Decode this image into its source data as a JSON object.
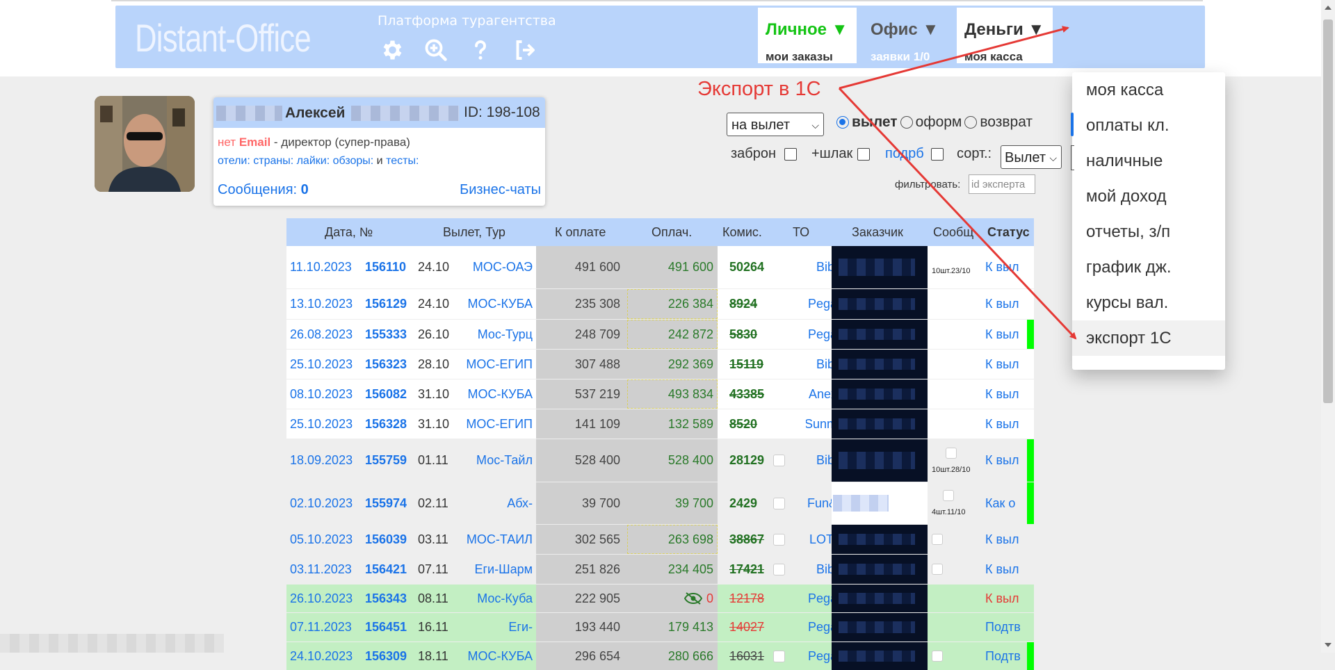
{
  "header": {
    "logo": "Distant-Office",
    "tagline": "Платформа турагентства",
    "icons": [
      "gear-icon",
      "search-plus-icon",
      "question-icon",
      "sign-out-icon"
    ],
    "tabs": {
      "personal": {
        "title": "Личное ▼",
        "sub": "мои заказы"
      },
      "office": {
        "title": "Офис ▼",
        "sub": "заявки 1/0"
      },
      "money": {
        "title": "Деньги ▼",
        "sub": "моя касса"
      }
    }
  },
  "dropdown": {
    "items": [
      "моя касса",
      "оплаты кл.",
      "наличные",
      "мой доход",
      "отчеты, з/п",
      "график дж.",
      "курсы вал.",
      "экспорт 1С"
    ]
  },
  "annotation": "Экспорт в 1С",
  "user": {
    "name": "Алексей",
    "id": "ID: 198-108",
    "no": "нет",
    "email": "Email",
    "role": " - директор (супер-права)",
    "links": [
      "отели:",
      "страны:",
      "лайки:",
      "обзоры:"
    ],
    "and": "и",
    "tests": "тесты:",
    "messages_label": "Сообщения:",
    "messages_count": "0",
    "business_chats": "Бизнес-чаты"
  },
  "filters": {
    "period": "на вылет",
    "radio_departure": "вылет",
    "radio_form": "оформ",
    "radio_return": "возврат",
    "cb_booking": "заброн",
    "cb_junk": "+шлак",
    "cb_details": "подрб",
    "sort_label": "сорт.:",
    "sort_value": "Вылет",
    "filter_label": "фильтровать:",
    "filter_placeholder": "id эксперта"
  },
  "table": {
    "columns": [
      "Дата, №",
      "Вылет, Тур",
      "К оплате",
      "Оплач.",
      "Комис.",
      "ТО",
      "Заказчик",
      "Сообщ",
      "Статус"
    ],
    "rows": [
      {
        "date": "11.10.2023",
        "num": "156110",
        "dep": "24.10",
        "tour": "МОС-ОАЭ",
        "pay": "491 600",
        "paid": "491 600",
        "com": "50264",
        "to": "Bibl",
        "msg": "10шт.23/10",
        "status": "К выл"
      },
      {
        "date": "13.10.2023",
        "num": "156129",
        "dep": "24.10",
        "tour": "МОС-КУБА",
        "pay": "235 308",
        "paid": "226 384",
        "com": "8924",
        "to": "Pega",
        "msg": "",
        "status": "К выл"
      },
      {
        "date": "26.08.2023",
        "num": "155333",
        "dep": "26.10",
        "tour": "Мос-Турц",
        "pay": "248 709",
        "paid": "242 872",
        "com": "5830",
        "to": "Pega",
        "msg": "",
        "status": "К выл"
      },
      {
        "date": "25.10.2023",
        "num": "156323",
        "dep": "28.10",
        "tour": "МОС-ЕГИП",
        "pay": "307 488",
        "paid": "292 369",
        "com": "15119",
        "to": "Bibl",
        "msg": "",
        "status": "К выл"
      },
      {
        "date": "08.10.2023",
        "num": "156082",
        "dep": "31.10",
        "tour": "МОС-КУБА",
        "pay": "537 219",
        "paid": "493 834",
        "com": "43385",
        "to": "Anex",
        "msg": "",
        "status": "К выл"
      },
      {
        "date": "25.10.2023",
        "num": "156328",
        "dep": "31.10",
        "tour": "МОС-ЕГИП",
        "pay": "141 109",
        "paid": "132 589",
        "com": "8520",
        "to": "Sunm",
        "msg": "",
        "status": "К выл"
      },
      {
        "date": "18.09.2023",
        "num": "155759",
        "dep": "01.11",
        "tour": "Мос-Тайл",
        "pay": "528 400",
        "paid": "528 400",
        "com": "28129",
        "to": "Bibl",
        "msg": "10шт.28/10",
        "status": "К выл"
      },
      {
        "date": "02.10.2023",
        "num": "155974",
        "dep": "02.11",
        "tour": "Абх-",
        "pay": "39 700",
        "paid": "39 700",
        "com": "2429",
        "to": "Fun&",
        "msg": "4шт.11/10",
        "status": "Как о"
      },
      {
        "date": "05.10.2023",
        "num": "156039",
        "dep": "03.11",
        "tour": "МОС-ТАИЛ",
        "pay": "302 565",
        "paid": "263 698",
        "com": "38867",
        "to": "LOTI",
        "msg": "",
        "status": "К выл"
      },
      {
        "date": "03.11.2023",
        "num": "156421",
        "dep": "07.11",
        "tour": "Еги-Шарм",
        "pay": "251 826",
        "paid": "234 405",
        "com": "17421",
        "to": "Bibl",
        "msg": "",
        "status": "К выл"
      },
      {
        "date": "26.10.2023",
        "num": "156343",
        "dep": "08.11",
        "tour": "Мос-Куба",
        "pay": "222 905",
        "paid": "0",
        "com": "12178",
        "to": "Pega",
        "msg": "",
        "status": "К выл"
      },
      {
        "date": "07.11.2023",
        "num": "156451",
        "dep": "16.11",
        "tour": "Еги-",
        "pay": "193 440",
        "paid": "179 413",
        "com": "14027",
        "to": "Pega",
        "msg": "",
        "status": "Подтв"
      },
      {
        "date": "24.10.2023",
        "num": "156309",
        "dep": "18.11",
        "tour": "МОС-КУБА",
        "pay": "296 654",
        "paid": "280 666",
        "com": "16031",
        "to": "Pega",
        "msg": "",
        "status": "Подтв"
      }
    ]
  },
  "colors": {
    "accent": "#1a73e8",
    "header_bg": "#b9d4fb",
    "green_tab": "#14c414",
    "annotation": "#e53935",
    "paid_row": "#c3efc3",
    "status_bar": "#00ff00"
  }
}
